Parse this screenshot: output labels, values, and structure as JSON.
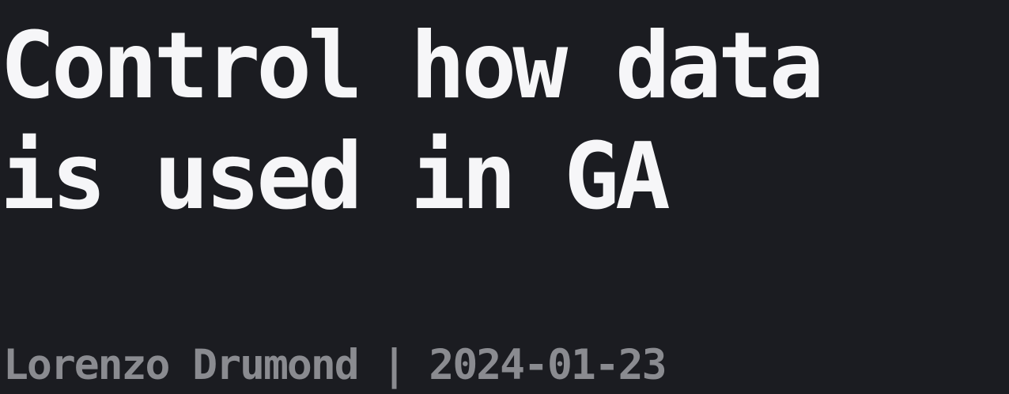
{
  "title": {
    "line1": "Control how data",
    "line2": "is used in GA"
  },
  "byline": {
    "author": "Lorenzo Drumond",
    "separator": "|",
    "date": "2024-01-23"
  },
  "colors": {
    "background": "#1b1c21",
    "title_text": "#f6f6f8",
    "byline_text": "#8a8b90"
  }
}
